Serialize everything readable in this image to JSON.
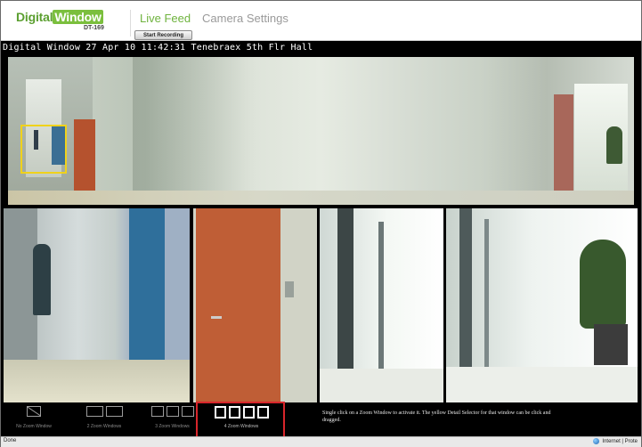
{
  "header": {
    "logo_text_1": "Digital",
    "logo_text_2": "Window",
    "logo_model": "DT-169",
    "nav": [
      {
        "label": "Live Feed",
        "active": true
      },
      {
        "label": "Camera Settings",
        "active": false
      }
    ],
    "record_button_label": "Start Recording"
  },
  "video": {
    "caption": "Digital Window 27 Apr 10 11:42:31  Tenebraex 5th Flr Hall"
  },
  "controls": {
    "layouts": [
      {
        "label": "No Zoom Window",
        "windows": 1
      },
      {
        "label": "2 Zoom Windows",
        "windows": 2
      },
      {
        "label": "3 Zoom Windows",
        "windows": 3
      },
      {
        "label": "4 Zoom Windows",
        "windows": 4,
        "selected": true
      }
    ],
    "help_text": "Single click on a Zoom Window to activate it. The yellow Detail Selector for that window can be click and dragged."
  },
  "status": {
    "left": "Done",
    "right": "Internet | Prote"
  },
  "colors": {
    "brand_green": "#6fb33e",
    "detail_selector": "#f0d21b",
    "selection_highlight": "#d8262b"
  }
}
